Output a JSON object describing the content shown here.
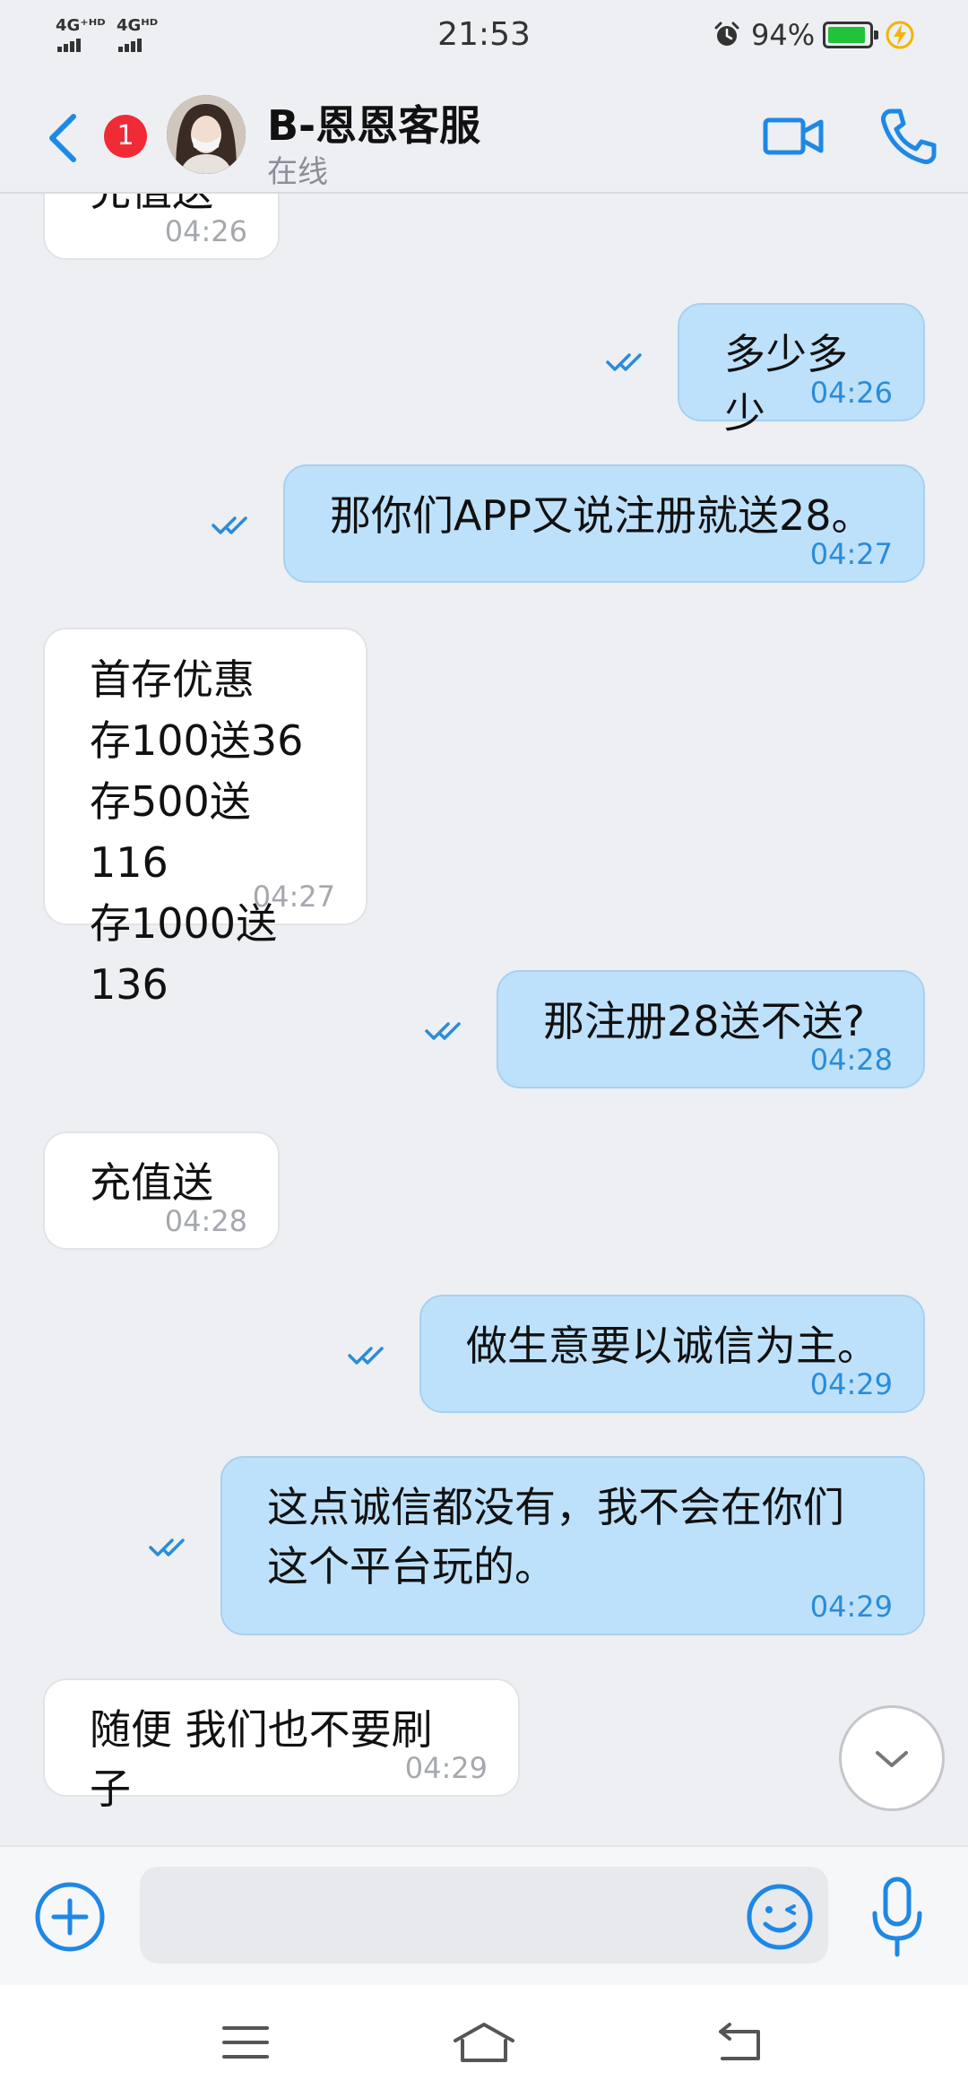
{
  "status_bar": {
    "signal1": "4G⁺ᴴᴰ",
    "signal2": "4Gᴴᴰ",
    "time": "21:53",
    "battery": "94%",
    "battery_level": 0.94,
    "battery_color": "#22C33A",
    "icons": [
      "alarm-icon",
      "battery-icon",
      "charging-icon"
    ]
  },
  "header": {
    "unread_count": "1",
    "contact_name": "B-恩恩客服",
    "contact_status": "在线",
    "accent_color": "#1E88E5",
    "icons": [
      "back-chevron-icon",
      "video-call-icon",
      "phone-call-icon"
    ]
  },
  "messages": [
    {
      "direction": "in",
      "text": "充值送",
      "time": "04:26",
      "partially_visible": true
    },
    {
      "direction": "out",
      "text": "多少多少",
      "time": "04:26",
      "read": true
    },
    {
      "direction": "out",
      "text": "那你们APP又说注册就送28。",
      "time": "04:27",
      "read": true
    },
    {
      "direction": "in",
      "text": "首存优惠\n存100送36\n存500送116\n存1000送136",
      "time": "04:27"
    },
    {
      "direction": "out",
      "text": "那注册28送不送?",
      "time": "04:28",
      "read": true
    },
    {
      "direction": "in",
      "text": "充值送",
      "time": "04:28"
    },
    {
      "direction": "out",
      "text": "做生意要以诚信为主。",
      "time": "04:29",
      "read": true
    },
    {
      "direction": "out",
      "text": "这点诚信都没有，我不会在你们\n这个平台玩的。",
      "time": "04:29",
      "read": true
    },
    {
      "direction": "in",
      "text": "随便 我们也不要刷子",
      "time": "04:29"
    }
  ],
  "input_bar": {
    "placeholder": "",
    "value": "",
    "icons": [
      "plus-icon",
      "emoji-icon",
      "microphone-icon"
    ]
  },
  "nav_bar": {
    "icons": [
      "menu-icon",
      "home-icon",
      "back-icon"
    ]
  },
  "colors": {
    "background": "#EDEFF3",
    "outgoing_bubble": "#BEE1FB",
    "incoming_bubble": "#FFFFFF",
    "unread_badge": "#F02B36"
  }
}
